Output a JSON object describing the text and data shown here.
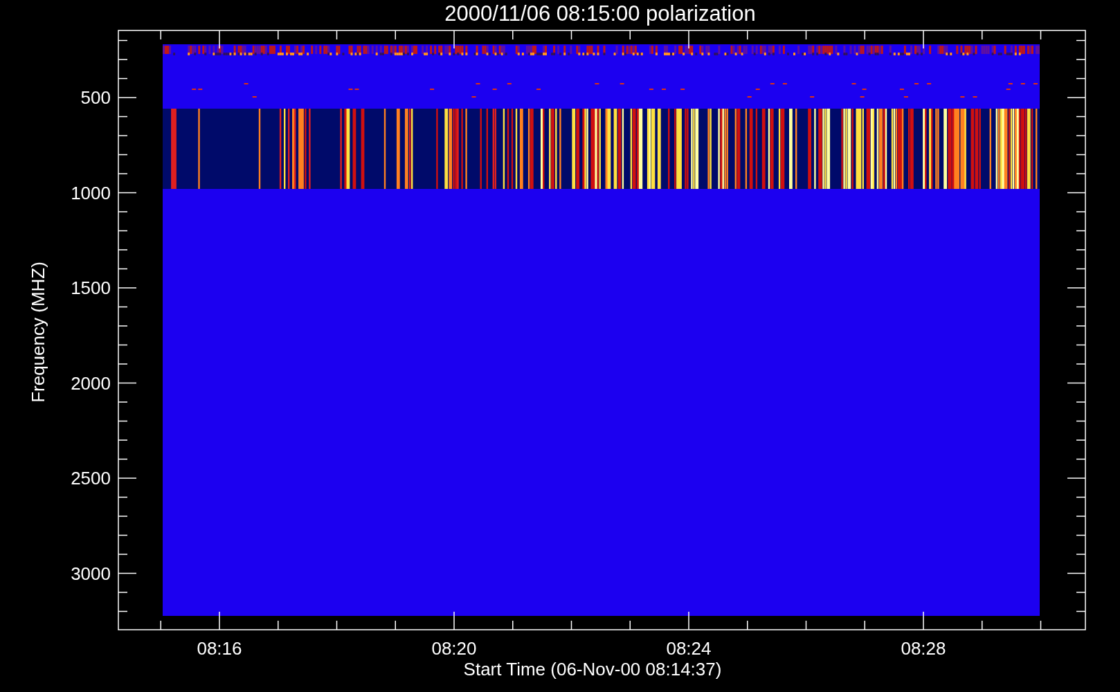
{
  "title": "2000/11/06 08:15:00 polarization",
  "y_axis": {
    "label": "Frequency (MHZ)",
    "ticks": [
      "500",
      "1000",
      "1500",
      "2000",
      "2500",
      "3000"
    ]
  },
  "x_axis": {
    "label": "Start Time (06-Nov-00 08:14:37)",
    "ticks": [
      "08:16",
      "08:20",
      "08:24",
      "08:28"
    ]
  }
}
